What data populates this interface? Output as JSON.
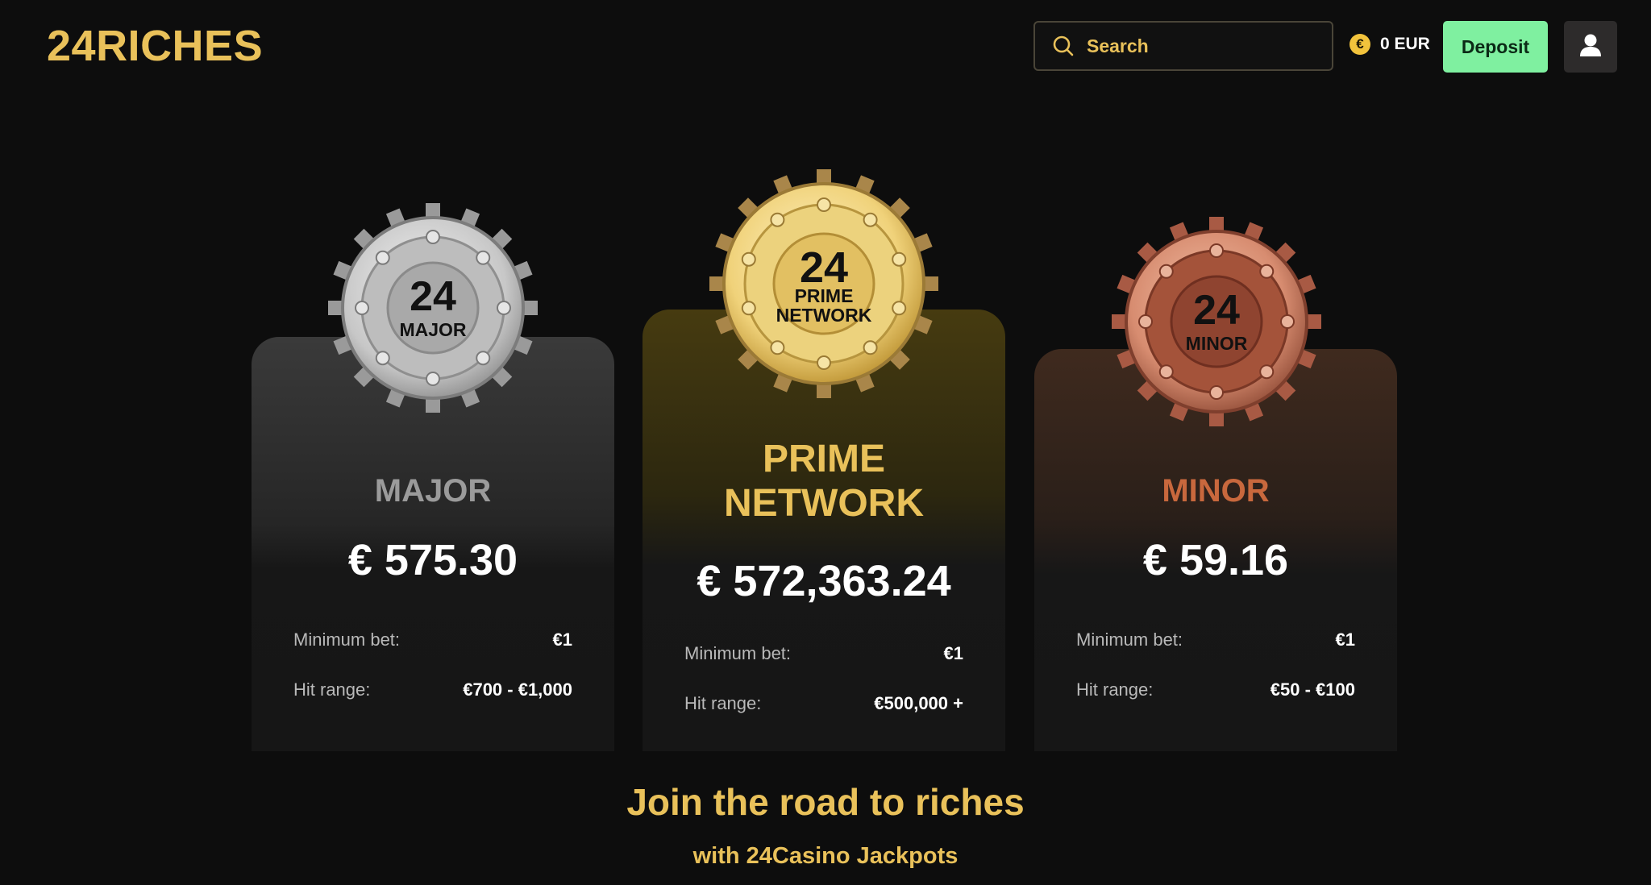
{
  "header": {
    "logo": "24RICHES",
    "search_placeholder": "Search",
    "balance": "0 EUR",
    "currency_symbol": "€",
    "deposit_label": "Deposit"
  },
  "jackpots": [
    {
      "badge_number": "24",
      "badge_label": "MAJOR",
      "title": "MAJOR",
      "amount": "€ 575.30",
      "min_bet_label": "Minimum bet:",
      "min_bet": "€1",
      "hit_range_label": "Hit range:",
      "hit_range": "€700 - €1,000",
      "title_color": "#9b9b9b"
    },
    {
      "badge_number": "24",
      "badge_label_line1": "PRIME",
      "badge_label_line2": "NETWORK",
      "title_line1": "PRIME",
      "title_line2": "NETWORK",
      "amount": "€ 572,363.24",
      "min_bet_label": "Minimum bet:",
      "min_bet": "€1",
      "hit_range_label": "Hit range:",
      "hit_range": "€500,000 +",
      "title_color": "#e9c15a"
    },
    {
      "badge_number": "24",
      "badge_label": "MINOR",
      "title": "MINOR",
      "amount": "€ 59.16",
      "min_bet_label": "Minimum bet:",
      "min_bet": "€1",
      "hit_range_label": "Hit range:",
      "hit_range": "€50 - €100",
      "title_color": "#c8683d"
    }
  ],
  "footer": {
    "title": "Join the road to riches",
    "subtitle": "with 24Casino Jackpots"
  },
  "colors": {
    "accent": "#e9c15a",
    "deposit": "#7ff0a0",
    "background": "#0d0d0d"
  }
}
